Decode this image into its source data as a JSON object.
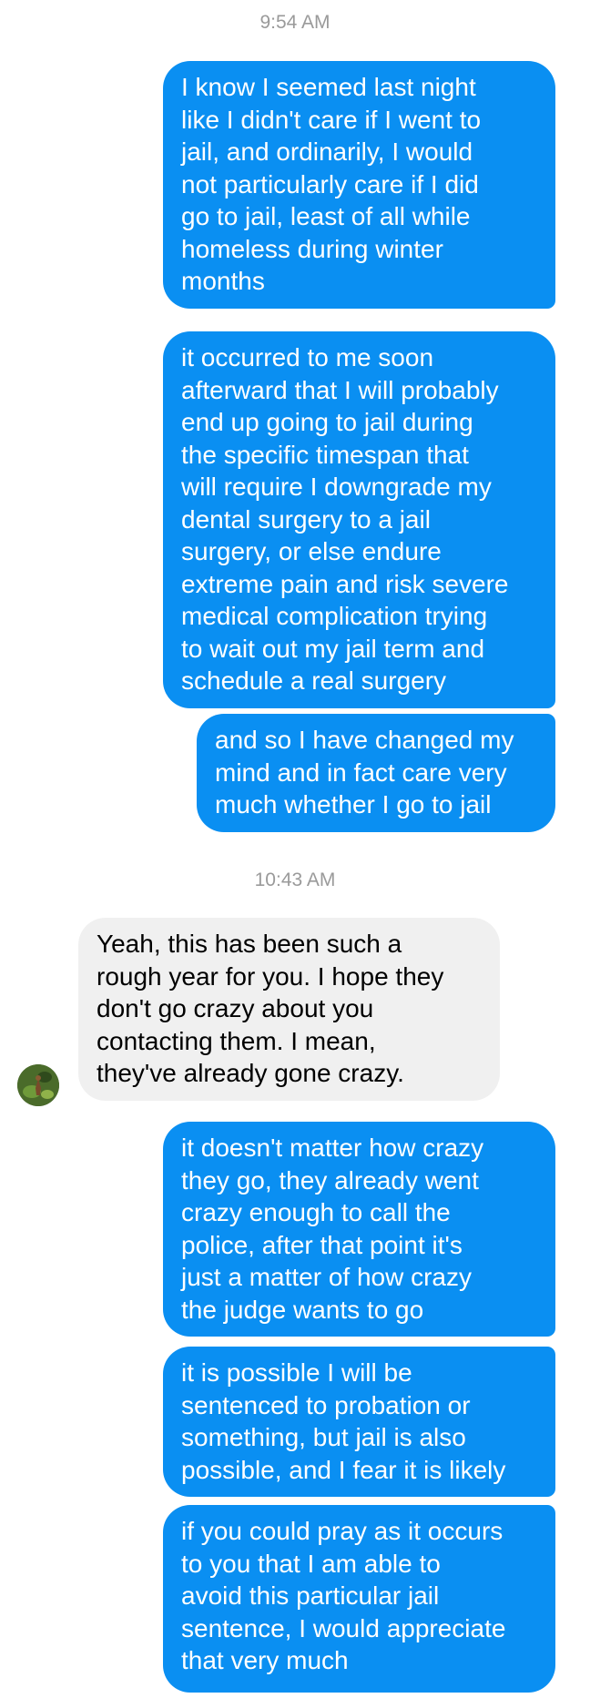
{
  "conversation": {
    "timestamp_1": "9:54 AM",
    "timestamp_2": "10:43 AM",
    "messages": [
      {
        "sender": "me",
        "lines": [
          "I know I seemed last night",
          "like I didn't care if I went to",
          "jail, and ordinarily, I would",
          "not particularly care if I did",
          "go to jail, least of all while",
          "homeless during winter",
          "months"
        ]
      },
      {
        "sender": "me",
        "lines": [
          "it occurred to me soon",
          "afterward that I will probably",
          "end up going to jail during",
          "the specific timespan that",
          "will require I downgrade my",
          "dental surgery to a jail",
          "surgery, or else endure",
          "extreme pain and risk severe",
          "medical complication trying",
          "to wait out my jail term and",
          "schedule a real surgery"
        ]
      },
      {
        "sender": "me",
        "lines": [
          "and so I have changed my",
          "mind and in fact care very",
          "much whether I go to jail"
        ]
      },
      {
        "sender": "them",
        "lines": [
          "Yeah, this has been such a",
          "rough year for you. I hope they",
          "don't go crazy about you",
          "contacting them. I mean,",
          "they've already gone crazy."
        ]
      },
      {
        "sender": "me",
        "lines": [
          "it doesn't matter how crazy",
          "they go, they already went",
          "crazy enough to call the",
          "police, after that point it's",
          "just a matter of how crazy",
          "the judge wants to go"
        ]
      },
      {
        "sender": "me",
        "lines": [
          "it is possible I will be",
          "sentenced to probation or",
          "something, but jail is also",
          "possible, and I fear it is likely"
        ]
      },
      {
        "sender": "me",
        "lines": [
          "if you could pray as it occurs",
          "to you that I am able to",
          "avoid this particular jail",
          "sentence, I would appreciate",
          "that very much"
        ]
      }
    ],
    "avatar_icon": "contact-avatar-photo",
    "colors": {
      "outgoing_bubble": "#0a8ff2",
      "incoming_bubble": "#f0f0f0",
      "timestamp_text": "#9a9a9a"
    }
  }
}
